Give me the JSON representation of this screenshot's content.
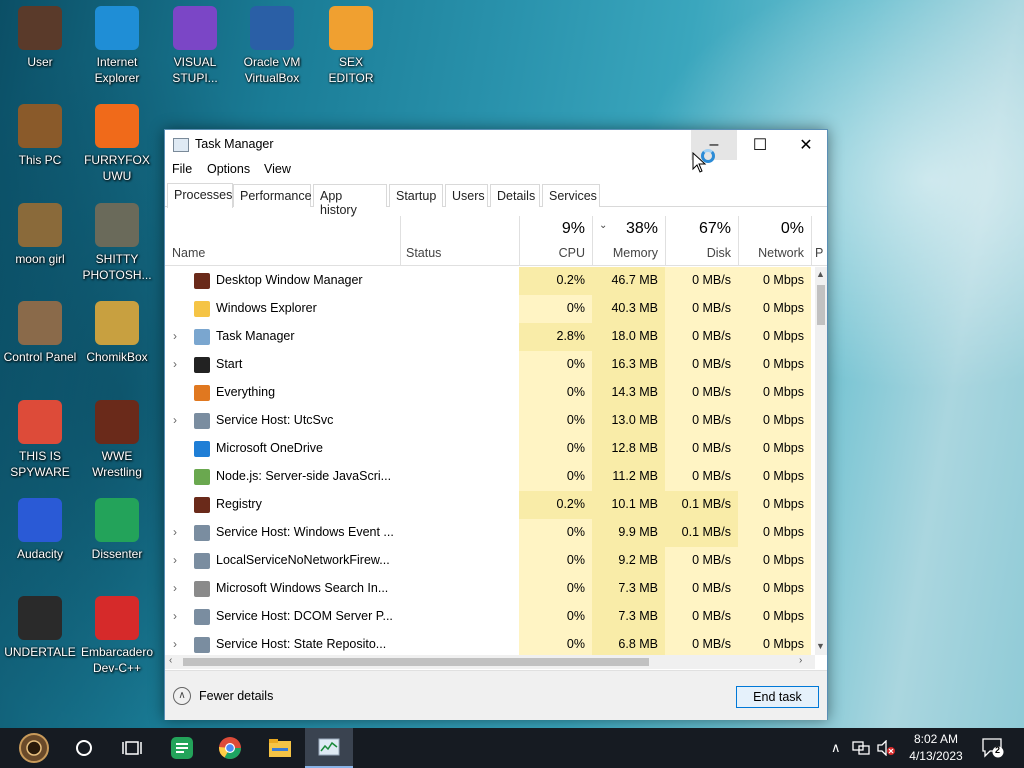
{
  "desktop": {
    "icons": [
      {
        "label": "User",
        "icon": "user-figure-icon",
        "color": "#5a3a2a"
      },
      {
        "label": "Internet\nExplorer",
        "icon": "edge-browser-icon",
        "color": "#1f8ed6"
      },
      {
        "label": "VISUAL\nSTUPI...",
        "icon": "visual-studio-icon",
        "color": "#7b46c6"
      },
      {
        "label": "Oracle VM\nVirtualBox",
        "icon": "virtualbox-icon",
        "color": "#2a5fa6"
      },
      {
        "label": "SEX\nEDITOR",
        "icon": "hex-editor-icon",
        "color": "#f0a030"
      },
      {
        "label": "This PC",
        "icon": "computer-icon",
        "color": "#8a5a2a"
      },
      {
        "label": "FURRYFOX\nUWU",
        "icon": "firefox-icon",
        "color": "#f06a1a"
      },
      {
        "label": "moon girl",
        "icon": "image-icon",
        "color": "#8a6a3a"
      },
      {
        "label": "SHITTY\nPHOTOSH...",
        "icon": "gimp-icon",
        "color": "#6a6a5a"
      },
      {
        "label": "Control Panel",
        "icon": "control-panel-icon",
        "color": "#8a6a4a"
      },
      {
        "label": "ChomikBox",
        "icon": "chomikbox-icon",
        "color": "#c8a040"
      },
      {
        "label": "THIS IS\nSPYWARE",
        "icon": "chrome-icon",
        "color": "#dd4b39"
      },
      {
        "label": "WWE\nWrestling",
        "icon": "wrestling-icon",
        "color": "#6a2a1a"
      },
      {
        "label": "Audacity",
        "icon": "audacity-icon",
        "color": "#2a5ad6"
      },
      {
        "label": "Dissenter",
        "icon": "dissenter-icon",
        "color": "#23a35a"
      },
      {
        "label": "UNDERTALE",
        "icon": "unity-icon",
        "color": "#2a2a2a"
      },
      {
        "label": "Embarcadero\nDev-C++",
        "icon": "devcpp-icon",
        "color": "#d62a2a"
      }
    ]
  },
  "window": {
    "title": "Task Manager",
    "controls": {
      "minimize": "–",
      "maximize": "☐",
      "close": "✕"
    },
    "menu": [
      "File",
      "Options",
      "View"
    ],
    "tabs": [
      "Processes",
      "Performance",
      "App history",
      "Startup",
      "Users",
      "Details",
      "Services"
    ],
    "active_tab": "Processes",
    "columns": {
      "name": "Name",
      "status": "Status",
      "cpu": {
        "pct": "9%",
        "label": "CPU"
      },
      "memory": {
        "pct": "38%",
        "label": "Memory"
      },
      "disk": {
        "pct": "67%",
        "label": "Disk"
      },
      "network": {
        "pct": "0%",
        "label": "Network"
      },
      "cut_off": "P"
    },
    "processes": [
      {
        "name": "Desktop Window Manager",
        "expand": "",
        "icon": "dwm-icon",
        "cpu": "0.2%",
        "mem": "46.7 MB",
        "disk": "0 MB/s",
        "net": "0 Mbps"
      },
      {
        "name": "Windows Explorer",
        "expand": "",
        "icon": "folder-icon",
        "cpu": "0%",
        "mem": "40.3 MB",
        "disk": "0 MB/s",
        "net": "0 Mbps"
      },
      {
        "name": "Task Manager",
        "expand": "›",
        "icon": "task-manager-icon",
        "cpu": "2.8%",
        "mem": "18.0 MB",
        "disk": "0 MB/s",
        "net": "0 Mbps"
      },
      {
        "name": "Start",
        "expand": "›",
        "icon": "start-icon",
        "cpu": "0%",
        "mem": "16.3 MB",
        "disk": "0 MB/s",
        "net": "0 Mbps"
      },
      {
        "name": "Everything",
        "expand": "",
        "icon": "magnifier-icon",
        "cpu": "0%",
        "mem": "14.3 MB",
        "disk": "0 MB/s",
        "net": "0 Mbps"
      },
      {
        "name": "Service Host: UtcSvc",
        "expand": "›",
        "icon": "gear-icon",
        "cpu": "0%",
        "mem": "13.0 MB",
        "disk": "0 MB/s",
        "net": "0 Mbps"
      },
      {
        "name": "Microsoft OneDrive",
        "expand": "",
        "icon": "cloud-icon",
        "cpu": "0%",
        "mem": "12.8 MB",
        "disk": "0 MB/s",
        "net": "0 Mbps"
      },
      {
        "name": "Node.js: Server-side JavaScri...",
        "expand": "",
        "icon": "nodejs-icon",
        "cpu": "0%",
        "mem": "11.2 MB",
        "disk": "0 MB/s",
        "net": "0 Mbps"
      },
      {
        "name": "Registry",
        "expand": "",
        "icon": "registry-icon",
        "cpu": "0.2%",
        "mem": "10.1 MB",
        "disk": "0.1 MB/s",
        "net": "0 Mbps"
      },
      {
        "name": "Service Host: Windows Event ...",
        "expand": "›",
        "icon": "gear-icon",
        "cpu": "0%",
        "mem": "9.9 MB",
        "disk": "0.1 MB/s",
        "net": "0 Mbps"
      },
      {
        "name": "LocalServiceNoNetworkFirew...",
        "expand": "›",
        "icon": "gear-icon",
        "cpu": "0%",
        "mem": "9.2 MB",
        "disk": "0 MB/s",
        "net": "0 Mbps"
      },
      {
        "name": "Microsoft Windows Search In...",
        "expand": "›",
        "icon": "search-indexer-icon",
        "cpu": "0%",
        "mem": "7.3 MB",
        "disk": "0 MB/s",
        "net": "0 Mbps"
      },
      {
        "name": "Service Host: DCOM Server P...",
        "expand": "›",
        "icon": "gear-icon",
        "cpu": "0%",
        "mem": "7.3 MB",
        "disk": "0 MB/s",
        "net": "0 Mbps"
      },
      {
        "name": "Service Host: State Reposito...",
        "expand": "›",
        "icon": "gear-icon",
        "cpu": "0%",
        "mem": "6.8 MB",
        "disk": "0 MB/s",
        "net": "0 Mbps"
      }
    ],
    "fewer_details": "Fewer details",
    "end_task": "End task"
  },
  "taskbar": {
    "items": [
      "start-button",
      "cortana-icon",
      "task-view-icon",
      "dissenter-icon",
      "chrome-icon",
      "file-explorer-icon",
      "task-manager-icon"
    ],
    "tray": {
      "chevron": "∧",
      "network": "network-icon",
      "volume": "volume-muted-icon"
    },
    "clock": {
      "time": "8:02 AM",
      "date": "4/13/2023"
    },
    "notifications": "2"
  },
  "colors": {
    "heat_light": "#fff4c4",
    "heat_mid": "#f9eca8",
    "accent": "#0078d7",
    "taskbar": "#161b22"
  }
}
